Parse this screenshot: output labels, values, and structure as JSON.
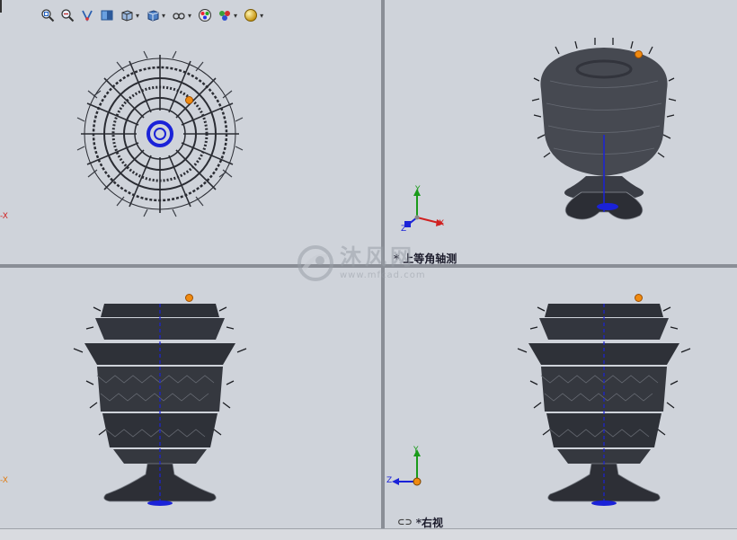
{
  "viewports": {
    "isometric_label": "上等角轴测",
    "isometric_prefix": "*",
    "right_label": "*右视",
    "right_link_icon": "link-icon"
  },
  "triad": {
    "x": "X",
    "y": "Y",
    "z": "Z"
  },
  "axis_fragment_top_left": "-X",
  "axis_fragment_bottom_left": "-X",
  "watermark": {
    "text": "沐风网",
    "url": "www.mfcad.com"
  },
  "toolbar": {
    "icons": [
      "zoom-to-fit-icon",
      "zoom-area-icon",
      "previous-view-icon",
      "section-view-icon",
      "view-orientation-icon",
      "display-style-icon",
      "hide-show-icon",
      "edit-appearance-icon",
      "apply-scene-icon",
      "view-settings-icon"
    ]
  },
  "colors": {
    "viewport_bg": "#cfd3da",
    "model": "#2a2c33",
    "axis_blue": "#1a22d8",
    "accent_orange": "#f08a10"
  }
}
